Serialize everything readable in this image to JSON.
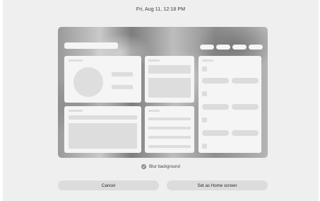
{
  "status": {
    "datetime": "Fri, Aug 11, 12:18 PM"
  },
  "options": {
    "blur_label": "Blur background",
    "blur_checked": true
  },
  "actions": {
    "cancel_label": "Cancel",
    "set_home_label": "Set as Home screen"
  },
  "colors": {
    "screen_bg": "#efefef",
    "button_bg": "#dcdcdc",
    "widget_bg": "#f5f5f5"
  },
  "icons": {
    "blur_check": "check-circle-icon"
  }
}
